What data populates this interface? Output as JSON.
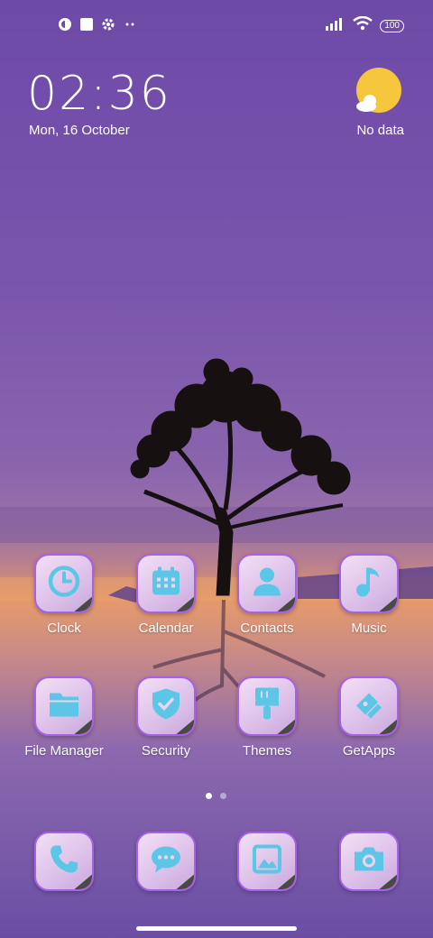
{
  "status_bar": {
    "left_icons": [
      "app-notification-icon",
      "square-notification-icon",
      "settings-icon",
      "more-dots-icon"
    ],
    "battery": "100",
    "right_icons": [
      "signal-icon",
      "wifi-icon",
      "battery-icon"
    ]
  },
  "clock_widget": {
    "time": "02:36",
    "date": "Mon, 16 October"
  },
  "weather_widget": {
    "icon": "sun-cloud-icon",
    "status": "No data"
  },
  "home_apps": [
    {
      "label": "Clock",
      "icon": "clock-icon"
    },
    {
      "label": "Calendar",
      "icon": "calendar-icon"
    },
    {
      "label": "Contacts",
      "icon": "contacts-icon"
    },
    {
      "label": "Music",
      "icon": "music-icon"
    },
    {
      "label": "File Manager",
      "icon": "folder-icon"
    },
    {
      "label": "Security",
      "icon": "shield-icon"
    },
    {
      "label": "Themes",
      "icon": "paintbrush-icon"
    },
    {
      "label": "GetApps",
      "icon": "getapps-icon"
    }
  ],
  "dock_apps": [
    {
      "icon": "phone-icon"
    },
    {
      "icon": "messages-icon"
    },
    {
      "icon": "gallery-icon"
    },
    {
      "icon": "camera-icon"
    }
  ],
  "page_indicator": {
    "pages": 2,
    "current": 1
  },
  "colors": {
    "icon_glyph": "#5cc6e6",
    "tile_border": "#a760e8",
    "sky_top": "#6e4aa8",
    "sunset": "#e59a6a"
  }
}
